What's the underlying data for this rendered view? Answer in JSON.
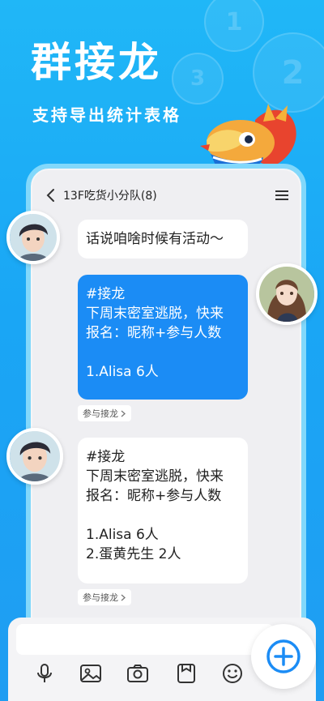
{
  "promo": {
    "headline": "群接龙",
    "subline": "支持导出统计表格",
    "bg_numbers": [
      "1",
      "2",
      "3"
    ]
  },
  "chat": {
    "title": "13F吃货小分队(8)",
    "messages": [
      {
        "lines": [
          "话说咱啥时候有活动～"
        ]
      },
      {
        "lines": [
          "#接龙",
          "下周末密室逃脱，快来",
          "报名：昵称+参与人数",
          "",
          "1.Alisa 6人"
        ]
      },
      {
        "lines": [
          "#接龙",
          "下周末密室逃脱，快来",
          "报名：昵称+参与人数",
          "",
          "1.Alisa 6人",
          "2.蛋黄先生 2人"
        ]
      }
    ],
    "join_chip_label": "参与接龙",
    "join_chip_label_2": "参与接龙"
  },
  "colors": {
    "background": "#1aa6f5",
    "bubble_blue": "#1b8cf5",
    "phone_frame": "#82d8fb",
    "icon": "#333333",
    "plus": "#1b8cf5"
  },
  "icons": {
    "back": "chevron-left-icon",
    "menu": "hamburger-menu-icon",
    "mic": "microphone-icon",
    "image": "image-icon",
    "camera": "camera-icon",
    "file": "folder-icon",
    "emoji": "emoji-icon",
    "plus": "plus-icon"
  }
}
